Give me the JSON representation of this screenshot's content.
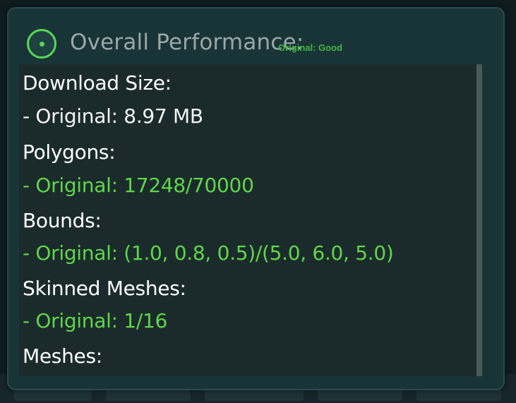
{
  "panel": {
    "title": "Overall Performance:",
    "status": "Original: Good",
    "status_icon": "status-ring-icon",
    "colors": {
      "good": "#5fd64a",
      "label": "#ffffff",
      "title": "#9aa8a6"
    }
  },
  "stats": [
    {
      "label": "Download Size:",
      "value": "- Original: 8.97 MB",
      "value_color": "white"
    },
    {
      "label": "Polygons:",
      "value": "- Original: 17248/70000",
      "value_color": "green"
    },
    {
      "label": "Bounds:",
      "value": "- Original: (1.0, 0.8, 0.5)/(5.0, 6.0, 5.0)",
      "value_color": "green"
    },
    {
      "label": "Skinned Meshes:",
      "value": "- Original: 1/16",
      "value_color": "green"
    },
    {
      "label": "Meshes:",
      "value": "",
      "value_color": "white"
    }
  ]
}
